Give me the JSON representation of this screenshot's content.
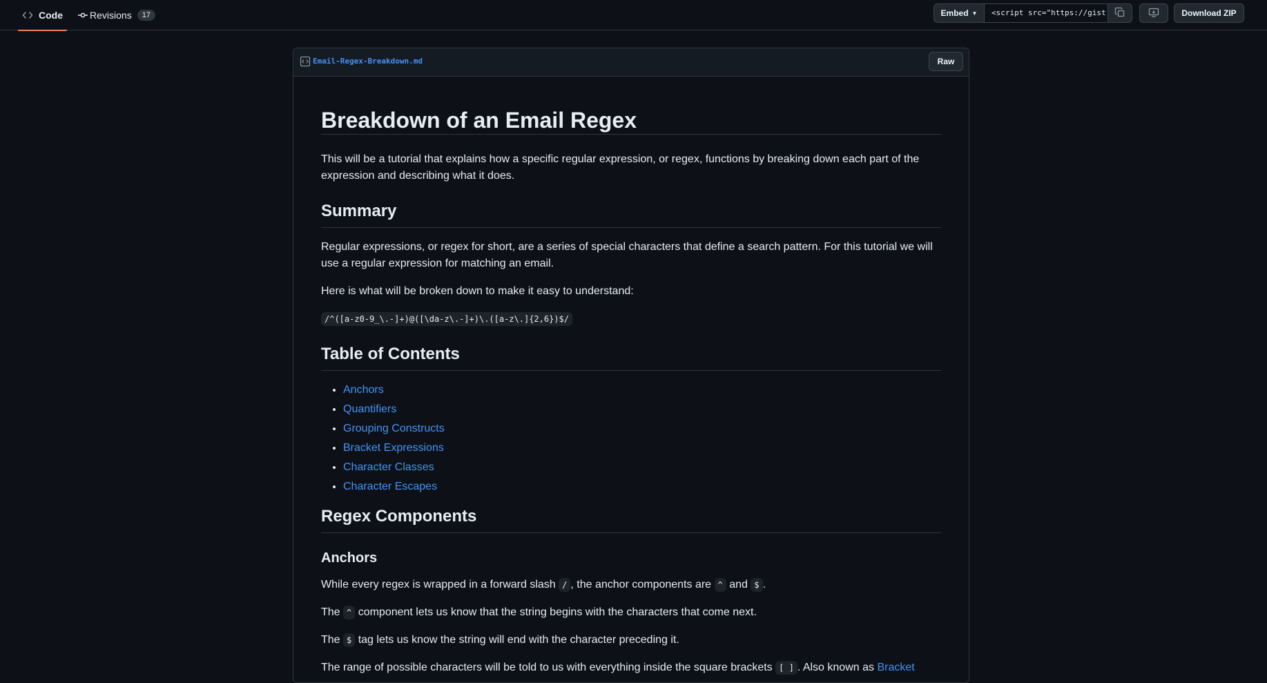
{
  "tabs": {
    "code_label": "Code",
    "revisions_label": "Revisions",
    "revisions_count": "17"
  },
  "actions": {
    "embed_label": "Embed",
    "embed_value": "<script src=\"https://gist.github.com",
    "download_zip_label": "Download ZIP"
  },
  "file": {
    "name": "Email-Regex-Breakdown.md",
    "raw_label": "Raw"
  },
  "doc": {
    "title": "Breakdown of an Email Regex",
    "intro": "This will be a tutorial that explains how a specific regular expression, or regex, functions by breaking down each part of the expression and describing what it does.",
    "summary_heading": "Summary",
    "summary_p1": "Regular expressions, or regex for short, are a series of special characters that define a search pattern. For this tutorial we will use a regular expression for matching an email.",
    "summary_p2": "Here is what will be broken down to make it easy to understand:",
    "regex": "/^([a-z0-9_\\.-]+)@([\\da-z\\.-]+)\\.([a-z\\.]{2,6})$/",
    "toc_heading": "Table of Contents",
    "toc": [
      "Anchors",
      "Quantifiers",
      "Grouping Constructs",
      "Bracket Expressions",
      "Character Classes",
      "Character Escapes"
    ],
    "components_heading": "Regex Components",
    "anchors_heading": "Anchors",
    "anchors_p1": {
      "a": "While every regex is wrapped in a forward slash ",
      "code1": "/",
      "b": ", the anchor components are ",
      "code2": "^",
      "c": " and ",
      "code3": "$",
      "d": "."
    },
    "anchors_p2": {
      "a": "The ",
      "code": "^",
      "b": " component lets us know that the string begins with the characters that come next."
    },
    "anchors_p3": {
      "a": "The ",
      "code": "$",
      "b": " tag lets us know the string will end with the character preceding it."
    },
    "anchors_p4": {
      "a": "The range of possible characters will be told to us with everything inside the square brackets ",
      "code": "[ ]",
      "b": ". Also known as ",
      "link": "Bracket"
    }
  }
}
